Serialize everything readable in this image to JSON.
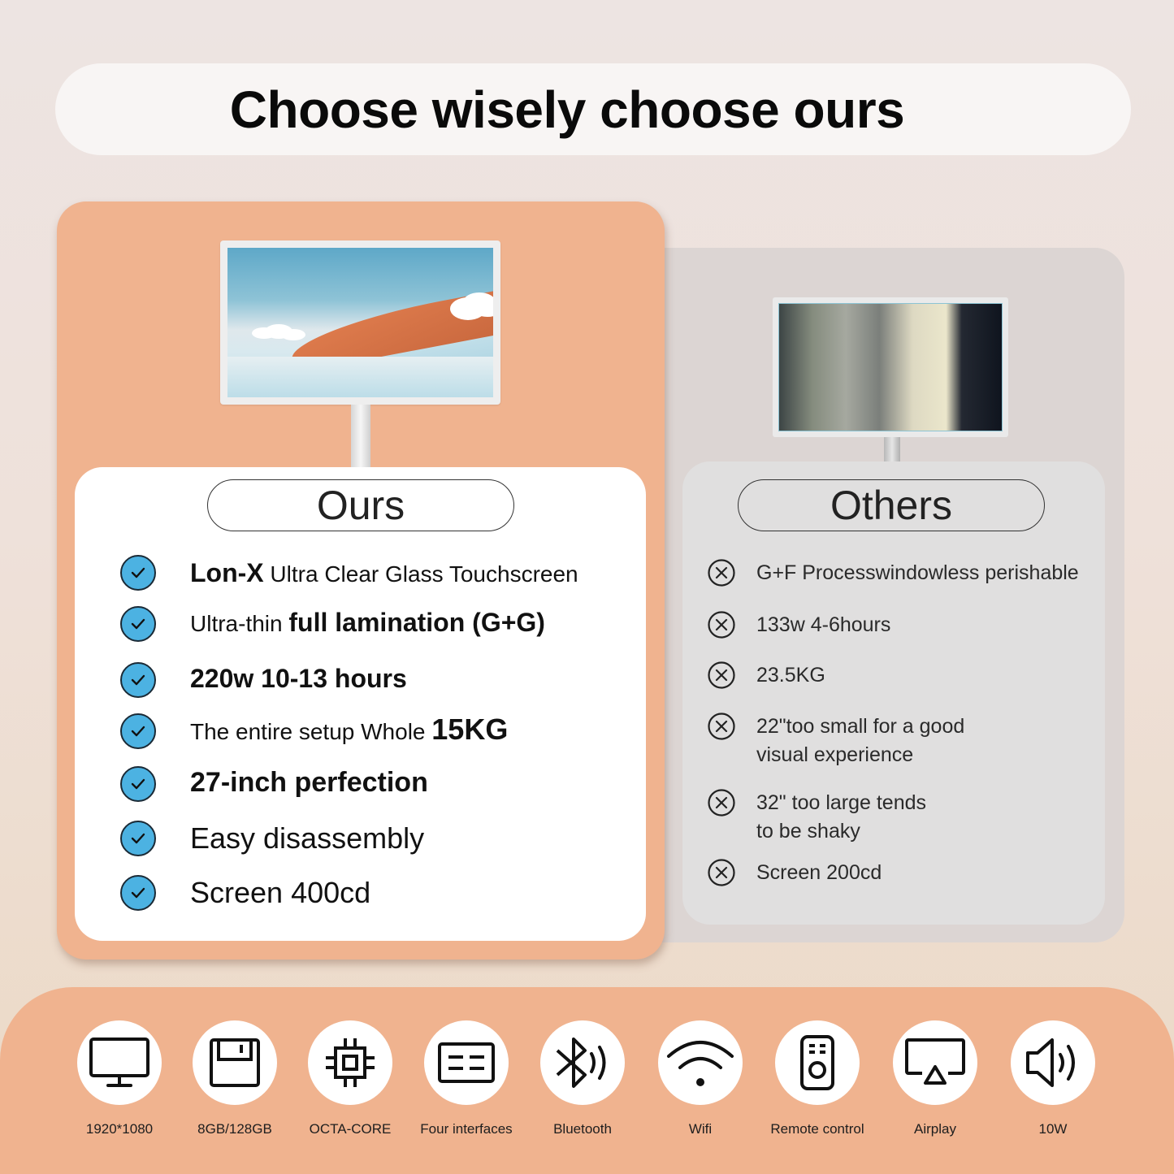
{
  "header": {
    "title": "Choose wisely choose ours"
  },
  "ours": {
    "label": "Ours",
    "items": [
      {
        "bold": "Lon-X",
        "text": " Ultra Clear Glass Touchscreen"
      },
      {
        "prefix": "Ultra-thin ",
        "bold": "full lamination (G+G)"
      },
      {
        "bold": "220w 10-13 hours"
      },
      {
        "prefix": "The entire setup Whole ",
        "bold": "15KG"
      },
      {
        "bold": "27-inch perfection"
      },
      {
        "text": "Easy disassembly"
      },
      {
        "text": "Screen 400cd"
      }
    ]
  },
  "others": {
    "label": "Others",
    "items": [
      {
        "line1": "G+F Processwindowless perishable"
      },
      {
        "line1": "133w 4-6hours"
      },
      {
        "line1": "23.5KG"
      },
      {
        "line1": "22\"too small for a good",
        "line2": "visual experience"
      },
      {
        "line1": "32\" too large tends",
        "line2": "to be shaky"
      },
      {
        "line1": "Screen 200cd"
      }
    ]
  },
  "features": [
    {
      "icon": "monitor-icon",
      "label": "1920*1080"
    },
    {
      "icon": "storage-icon",
      "label": "8GB/128GB"
    },
    {
      "icon": "cpu-chip-icon",
      "label": "OCTA-CORE"
    },
    {
      "icon": "interfaces-icon",
      "label": "Four interfaces"
    },
    {
      "icon": "bluetooth-icon",
      "label": "Bluetooth"
    },
    {
      "icon": "wifi-icon",
      "label": "Wifi"
    },
    {
      "icon": "remote-control-icon",
      "label": "Remote control"
    },
    {
      "icon": "airplay-icon",
      "label": "Airplay"
    },
    {
      "icon": "speaker-icon",
      "label": "10W"
    }
  ],
  "colors": {
    "accent_peach": "#f0b38f",
    "check_blue": "#4cb2e2",
    "others_gray": "#e0dfdf"
  }
}
